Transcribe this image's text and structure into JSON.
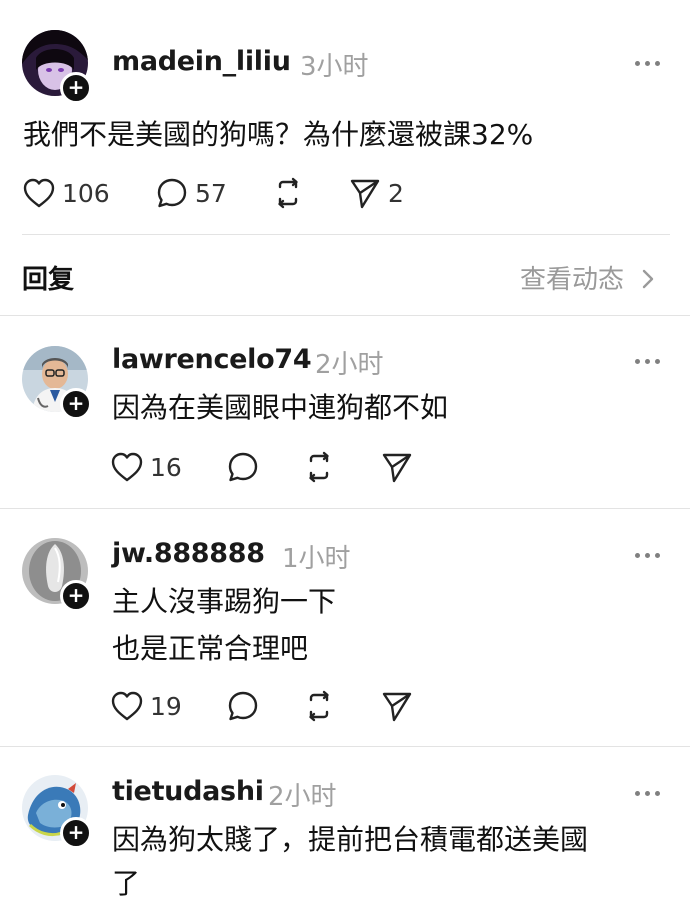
{
  "main_post": {
    "username": "madein_liliu",
    "time": "3小时",
    "text": "我們不是美國的狗嗎？為什麼還被課32%",
    "likes": "106",
    "comments": "57",
    "shares": "2"
  },
  "replies_header": {
    "label": "回复",
    "view_activity": "查看动态"
  },
  "replies": [
    {
      "username": "lawrencelo74",
      "time": "2小时",
      "lines": [
        "因為在美國眼中連狗都不如"
      ],
      "likes": "16"
    },
    {
      "username": "jw.888888",
      "time": "1小时",
      "lines": [
        "主人沒事踢狗一下",
        "也是正常合理吧"
      ],
      "likes": "19"
    },
    {
      "username": "tietudashi",
      "time": "2小时",
      "lines": [
        "因為狗太賤了，提前把台積電都送美國",
        "了"
      ]
    }
  ],
  "icons": {
    "heart": "heart-icon",
    "comment": "comment-icon",
    "repost": "repost-icon",
    "send": "send-icon",
    "more": "more-options-icon",
    "follow": "follow-plus-icon",
    "chevron": "chevron-right-icon"
  },
  "colors": {
    "text": "#111111",
    "secondary": "#a0a0a0",
    "divider": "#e3e3e3",
    "badge": "#111111"
  }
}
